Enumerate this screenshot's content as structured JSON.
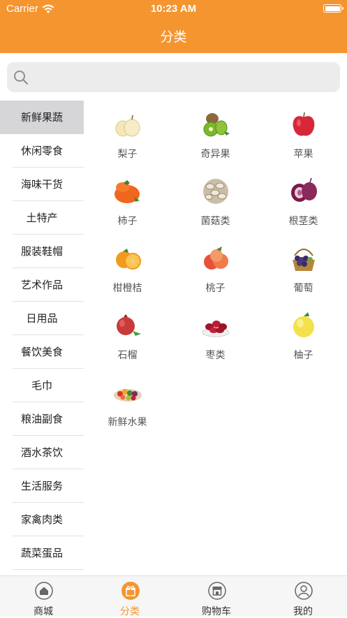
{
  "status_bar": {
    "carrier": "Carrier",
    "time": "10:23 AM"
  },
  "header": {
    "title": "分类"
  },
  "search": {
    "placeholder": ""
  },
  "sidebar": {
    "items": [
      {
        "label": "新鲜果蔬",
        "active": true
      },
      {
        "label": "休闲零食"
      },
      {
        "label": "海味干货"
      },
      {
        "label": "土特产"
      },
      {
        "label": "服装鞋帽"
      },
      {
        "label": "艺术作品"
      },
      {
        "label": "日用品"
      },
      {
        "label": "餐饮美食"
      },
      {
        "label": "毛巾"
      },
      {
        "label": "粮油副食"
      },
      {
        "label": "酒水茶饮"
      },
      {
        "label": "生活服务"
      },
      {
        "label": "家禽肉类"
      },
      {
        "label": "蔬菜蛋品"
      }
    ]
  },
  "categories": [
    {
      "label": "梨子",
      "icon": "pear-icon"
    },
    {
      "label": "奇异果",
      "icon": "kiwi-icon"
    },
    {
      "label": "苹果",
      "icon": "apple-icon"
    },
    {
      "label": "柿子",
      "icon": "persimmon-icon"
    },
    {
      "label": "菌菇类",
      "icon": "mushroom-icon"
    },
    {
      "label": "根茎类",
      "icon": "onion-icon"
    },
    {
      "label": "柑橙桔",
      "icon": "orange-icon"
    },
    {
      "label": "桃子",
      "icon": "peach-icon"
    },
    {
      "label": "葡萄",
      "icon": "grape-basket-icon"
    },
    {
      "label": "石榴",
      "icon": "pomegranate-icon"
    },
    {
      "label": "枣类",
      "icon": "jujube-icon"
    },
    {
      "label": "柚子",
      "icon": "pomelo-icon"
    },
    {
      "label": "新鲜水果",
      "icon": "fruit-platter-icon"
    }
  ],
  "tabbar": {
    "items": [
      {
        "label": "商城",
        "icon": "home-icon"
      },
      {
        "label": "分类",
        "icon": "gift-icon",
        "active": true
      },
      {
        "label": "购物车",
        "icon": "shop-icon"
      },
      {
        "label": "我的",
        "icon": "user-icon"
      }
    ]
  },
  "colors": {
    "accent": "#f5952f",
    "sidebar_active": "#d6d6d8",
    "search_bg": "#ececec"
  }
}
